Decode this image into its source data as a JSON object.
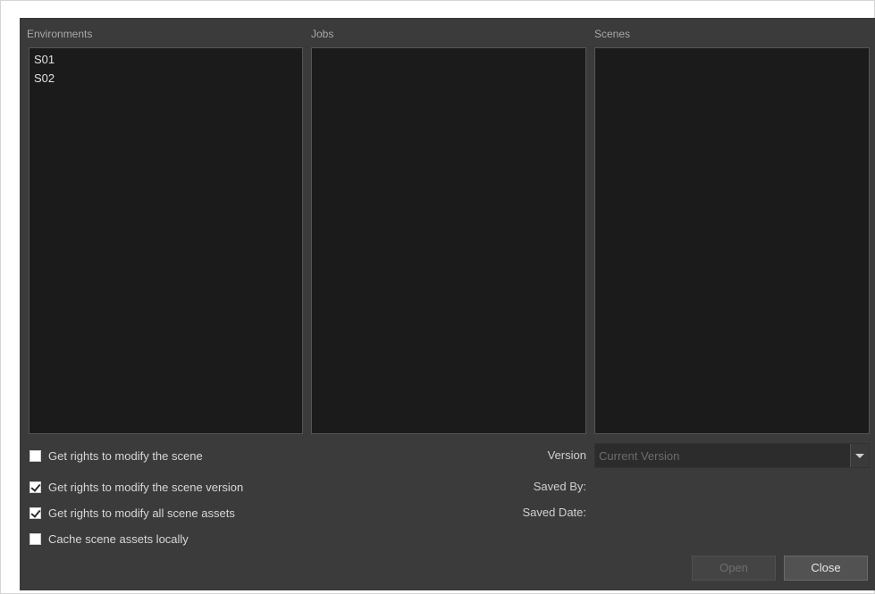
{
  "columns": {
    "environments": {
      "label": "Environments",
      "items": [
        "S01",
        "S02"
      ]
    },
    "jobs": {
      "label": "Jobs",
      "items": []
    },
    "scenes": {
      "label": "Scenes",
      "items": []
    }
  },
  "options": {
    "modify_scene": {
      "label": "Get rights to modify the scene",
      "checked": false
    },
    "modify_scene_version": {
      "label": "Get rights to modify the scene version",
      "checked": true
    },
    "modify_assets": {
      "label": "Get rights to modify all scene assets",
      "checked": true
    },
    "cache_assets": {
      "label": "Cache scene assets locally",
      "checked": false
    }
  },
  "details": {
    "version_label": "Version",
    "version_value": "Current Version",
    "saved_by_label": "Saved By:",
    "saved_by_value": "",
    "saved_date_label": "Saved Date:",
    "saved_date_value": ""
  },
  "buttons": {
    "open": "Open",
    "close": "Close"
  },
  "colors": {
    "dialog_bg": "#3b3b3b",
    "list_bg": "#1b1b1b",
    "disabled_text": "#6e6e6e"
  }
}
